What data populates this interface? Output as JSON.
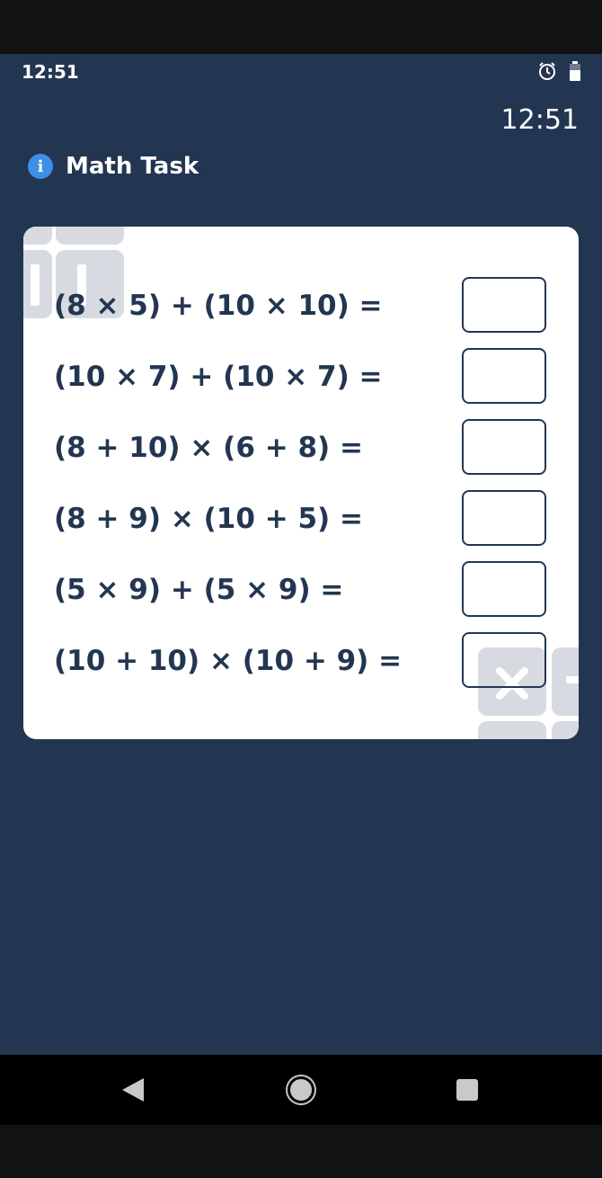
{
  "status_bar": {
    "time": "12:51",
    "icons": [
      "alarm-clock-icon",
      "battery-icon"
    ]
  },
  "clock": "12:51",
  "header": {
    "icon": "info-icon",
    "title": "Math Task"
  },
  "tasks": [
    {
      "expression": "(8 × 5) + (10 × 10) =",
      "answer": ""
    },
    {
      "expression": "(10 × 7) + (10 × 7) =",
      "answer": ""
    },
    {
      "expression": "(8 + 10) × (6 + 8) =",
      "answer": ""
    },
    {
      "expression": "(8 + 9) × (10 + 5) =",
      "answer": ""
    },
    {
      "expression": "(5 × 9) + (5 × 9) =",
      "answer": ""
    },
    {
      "expression": "(10 + 10) × (10 + 9) =",
      "answer": ""
    }
  ],
  "nav": {
    "back": "back-icon",
    "home": "home-icon",
    "recents": "recents-icon"
  },
  "colors": {
    "background": "#233651",
    "card": "#ffffff",
    "text_dark": "#233651",
    "info_accent": "#3d8fe6"
  }
}
